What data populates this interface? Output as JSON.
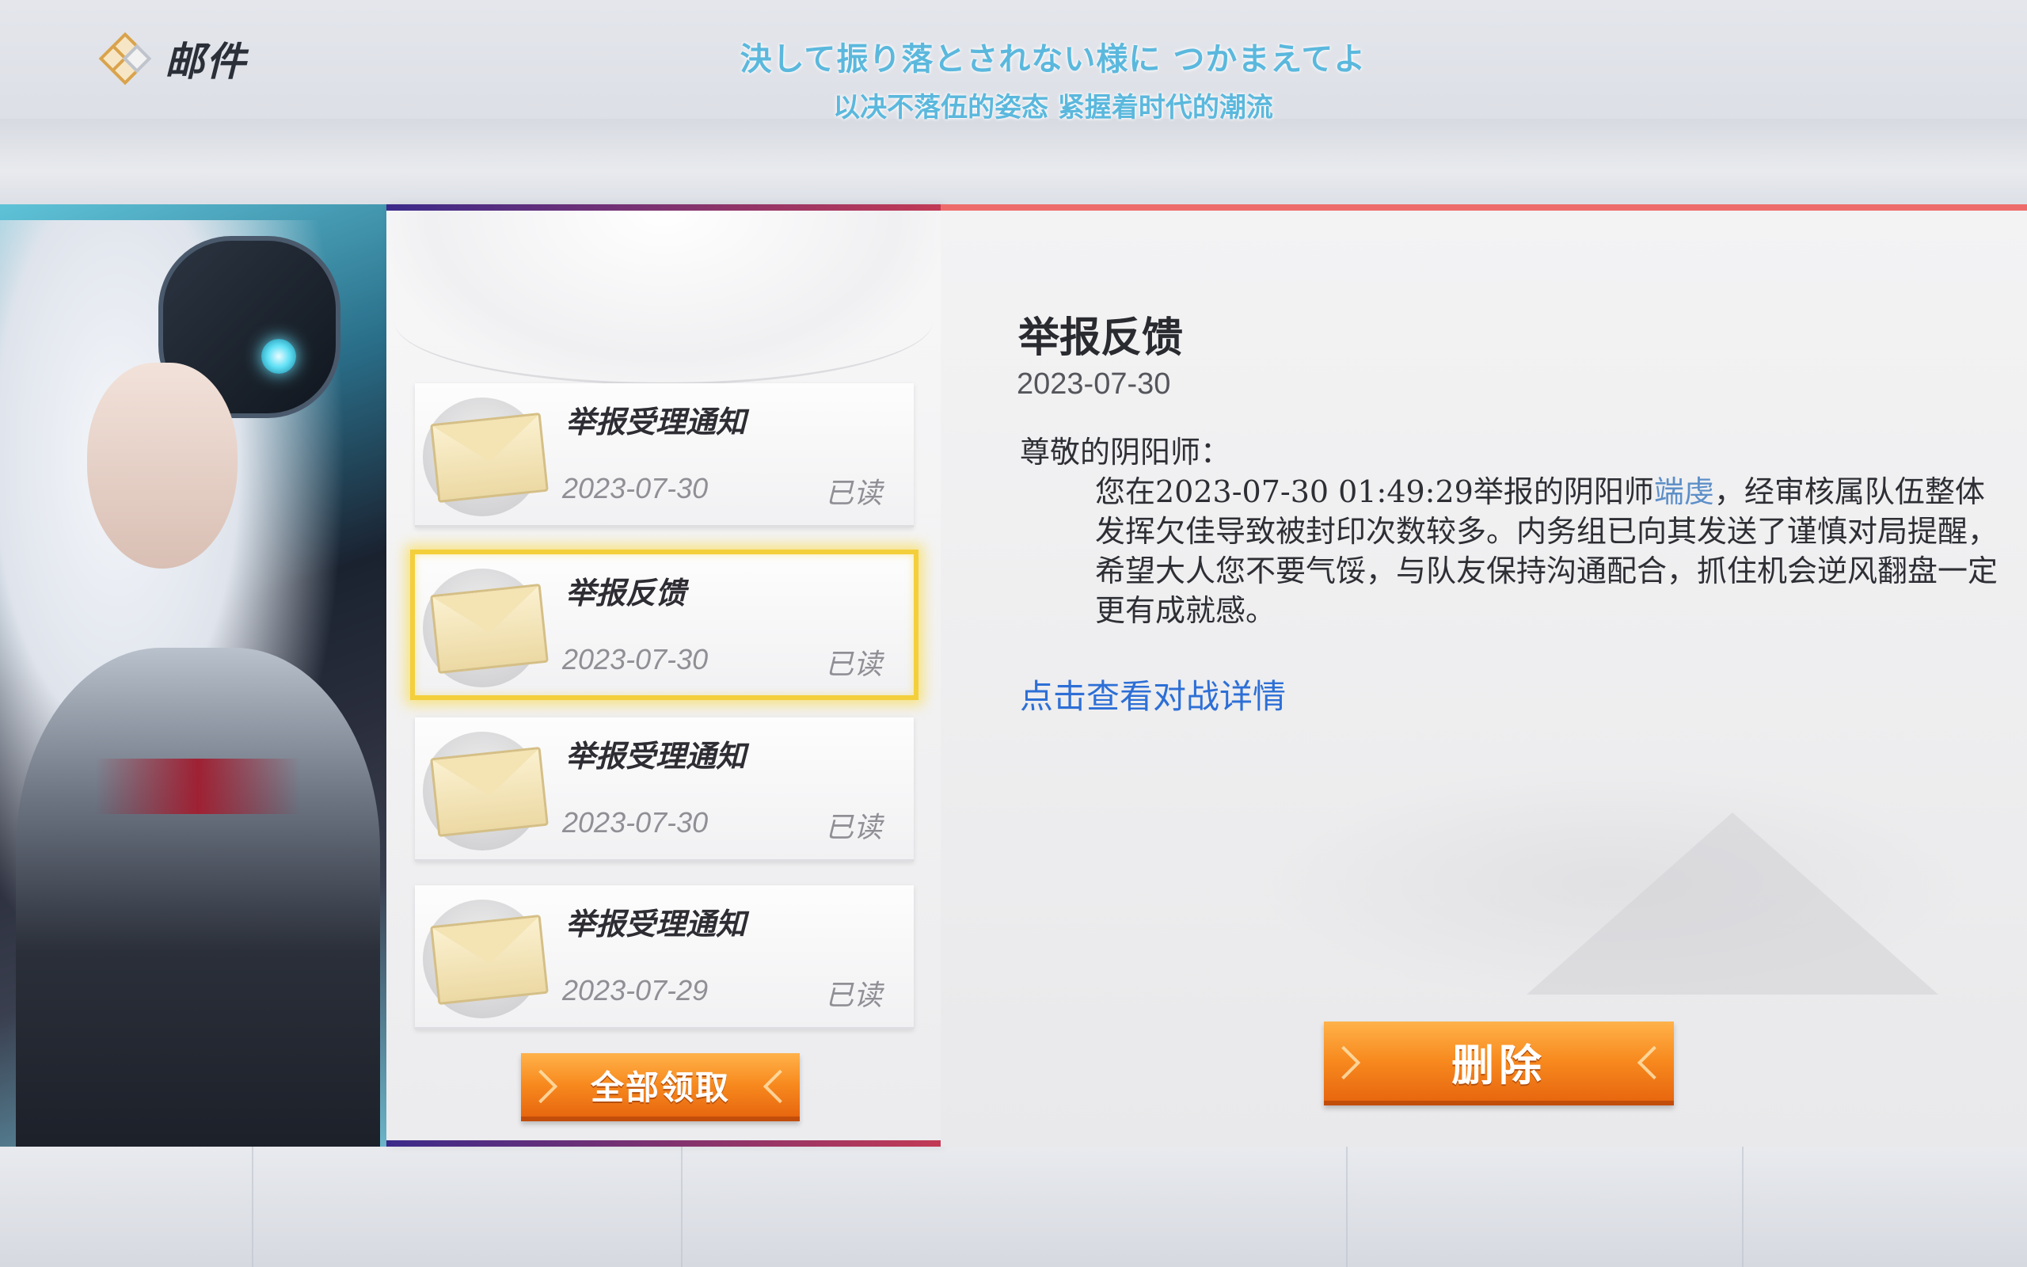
{
  "header": {
    "title": "邮件",
    "subtitle_jp": "決して振り落とされない様に つかまえてよ",
    "subtitle_cn": "以决不落伍的姿态 紧握着时代的潮流"
  },
  "mail_list": {
    "items": [
      {
        "title": "举报受理通知",
        "date": "2023-07-30",
        "status": "已读",
        "selected": false
      },
      {
        "title": "举报反馈",
        "date": "2023-07-30",
        "status": "已读",
        "selected": true
      },
      {
        "title": "举报受理通知",
        "date": "2023-07-30",
        "status": "已读",
        "selected": false
      },
      {
        "title": "举报受理通知",
        "date": "2023-07-29",
        "status": "已读",
        "selected": false
      }
    ],
    "claim_all_label": "全部领取"
  },
  "detail": {
    "title": "举报反馈",
    "date": "2023-07-30",
    "greeting": "尊敬的阴阳师：",
    "body_prefix": "您在2023-07-30 01:49:29举报的阴阳师",
    "reported_name": "端虔",
    "body_suffix": "，经审核属队伍整体发挥欠佳导致被封印次数较多。内务组已向其发送了谨慎对局提醒，希望大人您不要气馁，与队友保持沟通配合，抓住机会逆风翻盘一定更有成就感。",
    "link_text": "点击查看对战详情",
    "delete_label": "删除"
  },
  "colors": {
    "accent_red": "#ee6b6b",
    "button_orange": "#f7891e",
    "selected_border": "#f3cf3b",
    "link_blue": "#2d6fd6",
    "subtitle_blue": "#5bb8dd"
  }
}
